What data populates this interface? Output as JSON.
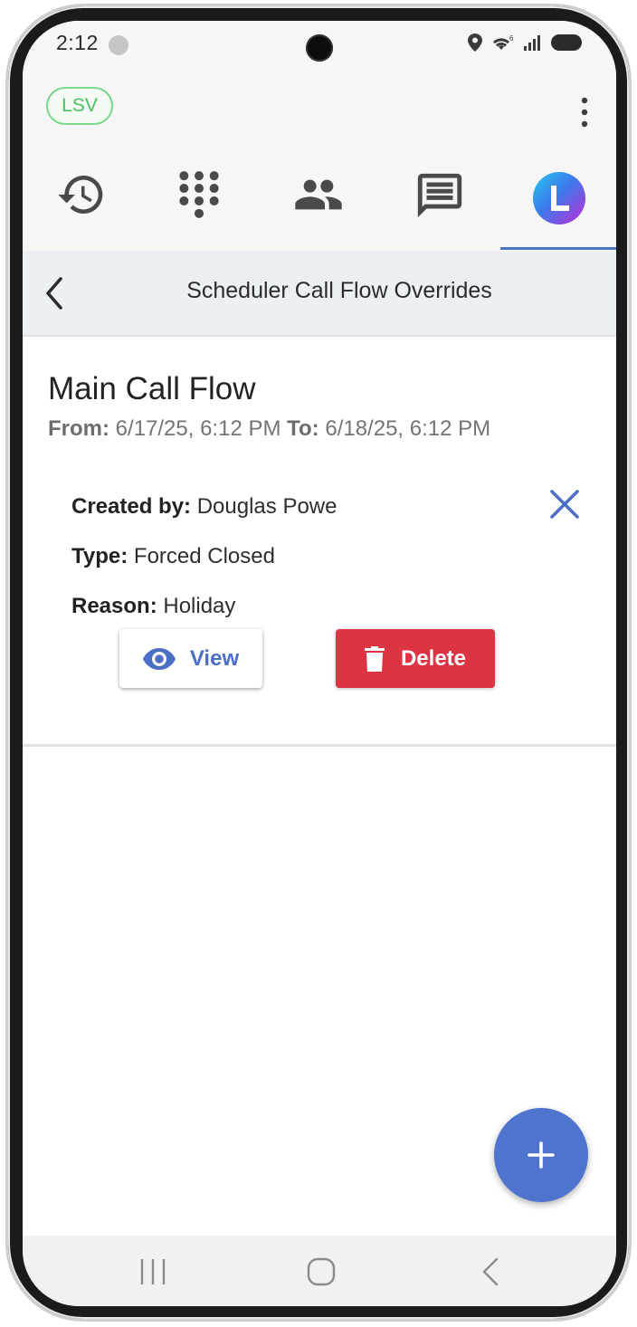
{
  "status_bar": {
    "time": "2:12",
    "icons": [
      "location-icon",
      "wifi-icon",
      "signal-icon",
      "battery-icon"
    ]
  },
  "header": {
    "badge": "LSV",
    "tabs": [
      {
        "name": "history",
        "icon": "history-icon"
      },
      {
        "name": "dialpad",
        "icon": "dialpad-icon"
      },
      {
        "name": "contacts",
        "icon": "contacts-icon"
      },
      {
        "name": "messages",
        "icon": "message-icon"
      },
      {
        "name": "profile",
        "icon": "app-logo-icon",
        "active": true
      }
    ]
  },
  "sub_header": {
    "title": "Scheduler Call Flow Overrides"
  },
  "override": {
    "title": "Main Call Flow",
    "from_label": "From:",
    "from_value": "6/17/25, 6:12 PM",
    "to_label": "To:",
    "to_value": "6/18/25, 6:12 PM",
    "created_by_label": "Created by:",
    "created_by_value": "Douglas Powe",
    "type_label": "Type:",
    "type_value": "Forced Closed",
    "reason_label": "Reason:",
    "reason_value": "Holiday",
    "view_label": "View",
    "delete_label": "Delete"
  },
  "colors": {
    "accent": "#4f74cd",
    "danger": "#dd3444",
    "badge_green": "#4cbf61",
    "subheader_bg": "#eceff4"
  }
}
